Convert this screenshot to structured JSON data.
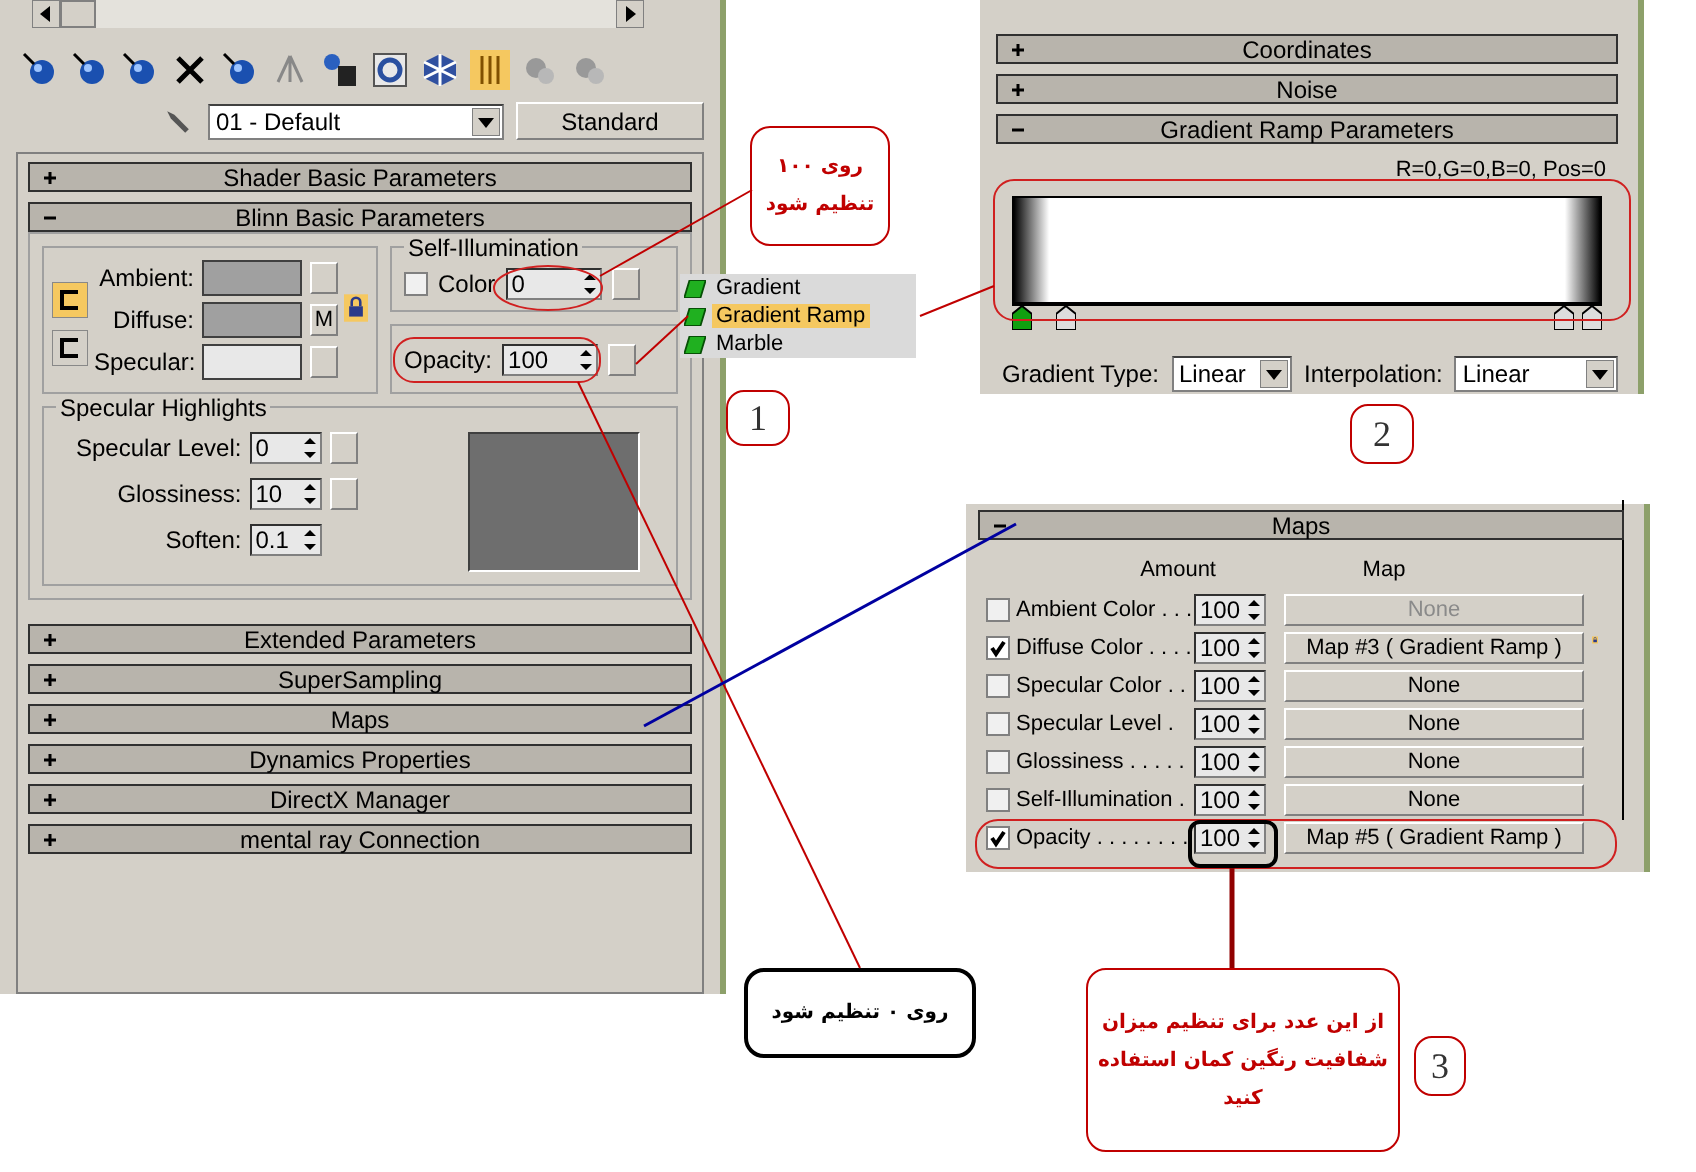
{
  "material_editor": {
    "material_name": "01 - Default",
    "material_type": "Standard",
    "rollouts_top": [
      {
        "title": "Shader Basic Parameters",
        "expanded": false
      },
      {
        "title": "Blinn Basic Parameters",
        "expanded": true
      }
    ],
    "blinn": {
      "colors": [
        {
          "label": "Ambient:",
          "color": "#a0a0a0"
        },
        {
          "label": "Diffuse:",
          "color": "#a0a0a0",
          "map_button": "M"
        },
        {
          "label": "Specular:",
          "color": "#e8e8e8"
        }
      ],
      "self_illumination": {
        "title": "Self-Illumination",
        "checkbox_label": "Color",
        "checked": false,
        "value": "0"
      },
      "opacity": {
        "label": "Opacity:",
        "value": "100"
      },
      "specular_highlights": {
        "title": "Specular Highlights",
        "fields": [
          {
            "label": "Specular Level:",
            "value": "0"
          },
          {
            "label": "Glossiness:",
            "value": "10"
          },
          {
            "label": "Soften:",
            "value": "0.1"
          }
        ]
      }
    },
    "rollouts_bottom": [
      {
        "title": "Extended Parameters",
        "expanded": false
      },
      {
        "title": "SuperSampling",
        "expanded": false
      },
      {
        "title": "Maps",
        "expanded": false
      },
      {
        "title": "Dynamics Properties",
        "expanded": false
      },
      {
        "title": "DirectX Manager",
        "expanded": false
      },
      {
        "title": "mental ray Connection",
        "expanded": false
      }
    ]
  },
  "map_browser": {
    "items": [
      {
        "name": "Gradient",
        "selected": false
      },
      {
        "name": "Gradient Ramp",
        "selected": true
      },
      {
        "name": "Marble",
        "selected": false
      }
    ]
  },
  "gradient_ramp_panel": {
    "rollouts": [
      {
        "title": "Coordinates",
        "expanded": false
      },
      {
        "title": "Noise",
        "expanded": false
      },
      {
        "title": "Gradient Ramp Parameters",
        "expanded": true
      }
    ],
    "readout": "R=0,G=0,B=0, Pos=0",
    "gradient_type_label": "Gradient Type:",
    "gradient_type": "Linear",
    "interpolation_label": "Interpolation:",
    "interpolation": "Linear"
  },
  "maps_panel": {
    "title": "Maps",
    "expanded": true,
    "columns": [
      "Amount",
      "Map"
    ],
    "rows": [
      {
        "label": "Ambient Color . . .",
        "checked": false,
        "amount": "100",
        "map": "None",
        "disabled": true
      },
      {
        "label": "Diffuse Color . . . .",
        "checked": true,
        "amount": "100",
        "map": "Map #3  ( Gradient Ramp )",
        "disabled": false
      },
      {
        "label": "Specular Color . .",
        "checked": false,
        "amount": "100",
        "map": "None",
        "disabled": false
      },
      {
        "label": "Specular Level .",
        "checked": false,
        "amount": "100",
        "map": "None",
        "disabled": false
      },
      {
        "label": "Glossiness . . . . .",
        "checked": false,
        "amount": "100",
        "map": "None",
        "disabled": false
      },
      {
        "label": "Self-Illumination .",
        "checked": false,
        "amount": "100",
        "map": "None",
        "disabled": false
      },
      {
        "label": "Opacity . . . . . . . .",
        "checked": true,
        "amount": "100",
        "map": "Map #5  ( Gradient Ramp )",
        "disabled": false
      }
    ]
  },
  "annotations": {
    "callouts": [
      {
        "kind": "red",
        "text": "روی ۱۰۰ تنظیم شود"
      },
      {
        "kind": "red",
        "text": "از این عدد برای تنظیم میزان شفافیت رنگین کمان استفاده کنید"
      },
      {
        "kind": "black",
        "text": "روی ۰ تنظیم شود"
      }
    ],
    "step_numbers": [
      "1",
      "2",
      "3"
    ]
  }
}
